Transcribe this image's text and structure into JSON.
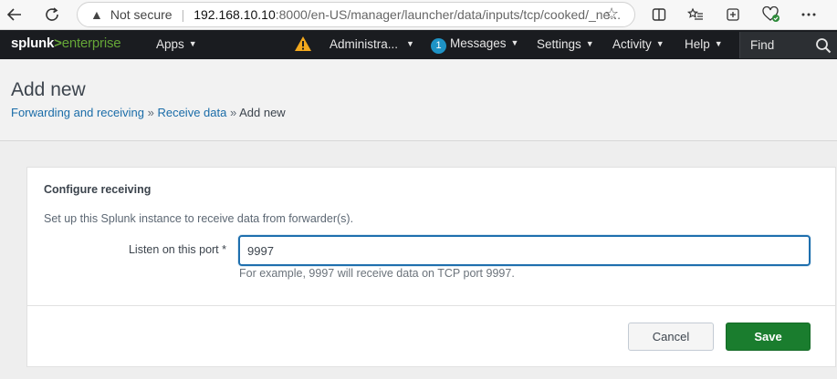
{
  "browser": {
    "security_label": "Not secure",
    "url_host": "192.168.10.10",
    "url_path": ":8000/en-US/manager/launcher/data/inputs/tcp/cooked/_ne..."
  },
  "splunk_nav": {
    "logo_prefix": "splunk",
    "logo_gt": ">",
    "logo_suffix": "enterprise",
    "apps": "Apps",
    "administrator": "Administra...",
    "messages_count": "1",
    "messages": "Messages",
    "settings": "Settings",
    "activity": "Activity",
    "help": "Help",
    "find_placeholder": "Find"
  },
  "page": {
    "title": "Add new",
    "breadcrumb": {
      "link1": "Forwarding and receiving",
      "separator": "»",
      "link2": "Receive data",
      "current": "Add new"
    }
  },
  "form": {
    "section_title": "Configure receiving",
    "description": "Set up this Splunk instance to receive data from forwarder(s).",
    "port_label": "Listen on this port *",
    "port_value": "9997",
    "help_text": "For example, 9997 will receive data on TCP port 9997.",
    "cancel_label": "Cancel",
    "save_label": "Save"
  }
}
